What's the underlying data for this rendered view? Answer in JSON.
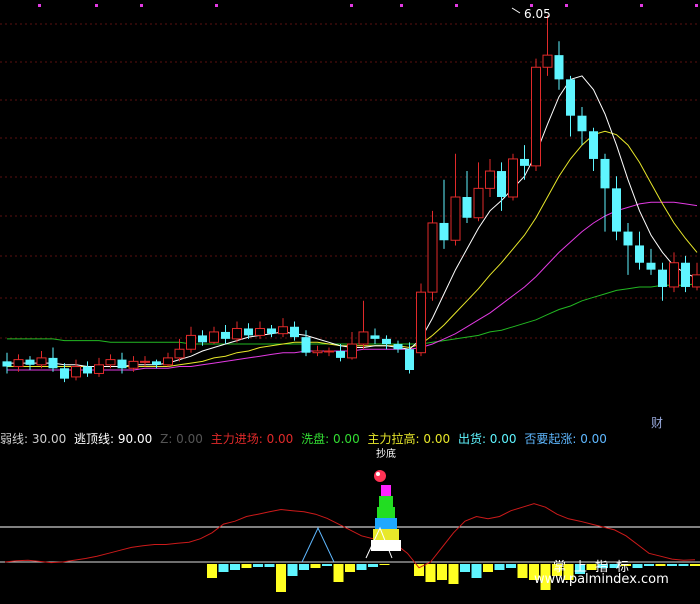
{
  "colors": {
    "background": "#000000",
    "up_candle": "#e02a2a",
    "down_candle": "#5ff5ff",
    "grid": "#5a1010",
    "ma_white": "#ffffff",
    "ma_yellow": "#e8e82a",
    "ma_magenta": "#e23ae2",
    "ma_green": "#22b822",
    "red_line": "#cc1a1a",
    "bar_yellow": "#ffff22",
    "bar_cyan": "#5ff5ff"
  },
  "main_chart": {
    "peak_label": "6.05",
    "corner_label": "财"
  },
  "indicator_bar": [
    {
      "text": "弱线: 30.00",
      "color": "#cfcfcf"
    },
    {
      "text": "逃顶线: 90.00",
      "color": "#ffffff"
    },
    {
      "text": "Z: 0.00",
      "color": "#555555"
    },
    {
      "text": "主力进场: 0.00",
      "color": "#e02a2a"
    },
    {
      "text": "洗盘: 0.00",
      "color": "#33dd33"
    },
    {
      "text": "主力拉高: 0.00",
      "color": "#e8e82a"
    },
    {
      "text": "出货: 0.00",
      "color": "#5ff5ff"
    },
    {
      "text": "否要起涨: 0.00",
      "color": "#5fb8ff"
    }
  ],
  "sub_chart": {
    "top_label": "抄底",
    "lines": [
      {
        "name": "逃顶线",
        "value": 90
      },
      {
        "name": "弱线",
        "value": 30
      }
    ]
  },
  "watermark": {
    "cn": "掌上指标",
    "url": "www.palmindex.com"
  },
  "chart_data": {
    "type": "candlestick",
    "candles": [
      [
        4.05,
        4.02,
        4.1,
        3.98
      ],
      [
        4.02,
        4.06,
        4.09,
        3.99
      ],
      [
        4.06,
        4.03,
        4.08,
        4.0
      ],
      [
        4.03,
        4.07,
        4.11,
        4.01
      ],
      [
        4.07,
        4.01,
        4.13,
        3.99
      ],
      [
        4.01,
        3.95,
        4.04,
        3.93
      ],
      [
        3.96,
        4.02,
        4.06,
        3.94
      ],
      [
        4.02,
        3.98,
        4.05,
        3.96
      ],
      [
        3.98,
        4.03,
        4.07,
        3.96
      ],
      [
        4.03,
        4.06,
        4.09,
        4.01
      ],
      [
        4.06,
        4.01,
        4.1,
        3.98
      ],
      [
        4.01,
        4.05,
        4.08,
        3.99
      ],
      [
        4.05,
        4.05,
        4.08,
        4.02
      ],
      [
        4.05,
        4.03,
        4.06,
        4.01
      ],
      [
        4.03,
        4.07,
        4.1,
        4.02
      ],
      [
        4.07,
        4.12,
        4.18,
        4.05
      ],
      [
        4.12,
        4.2,
        4.25,
        4.1
      ],
      [
        4.2,
        4.16,
        4.23,
        4.14
      ],
      [
        4.16,
        4.22,
        4.25,
        4.15
      ],
      [
        4.22,
        4.18,
        4.26,
        4.15
      ],
      [
        4.18,
        4.24,
        4.28,
        4.16
      ],
      [
        4.24,
        4.2,
        4.27,
        4.18
      ],
      [
        4.2,
        4.24,
        4.28,
        4.18
      ],
      [
        4.24,
        4.21,
        4.26,
        4.19
      ],
      [
        4.21,
        4.25,
        4.3,
        4.19
      ],
      [
        4.25,
        4.19,
        4.28,
        4.17
      ],
      [
        4.19,
        4.1,
        4.23,
        4.08
      ],
      [
        4.1,
        4.11,
        4.14,
        4.08
      ],
      [
        4.11,
        4.11,
        4.13,
        4.08
      ],
      [
        4.11,
        4.07,
        4.15,
        4.05
      ],
      [
        4.07,
        4.15,
        4.22,
        4.06
      ],
      [
        4.15,
        4.22,
        4.4,
        4.12
      ],
      [
        4.2,
        4.18,
        4.24,
        4.15
      ],
      [
        4.18,
        4.15,
        4.2,
        4.12
      ],
      [
        4.15,
        4.12,
        4.17,
        4.1
      ],
      [
        4.12,
        4.0,
        4.16,
        3.98
      ],
      [
        4.1,
        4.45,
        4.5,
        4.08
      ],
      [
        4.45,
        4.85,
        4.92,
        4.4
      ],
      [
        4.85,
        4.75,
        5.1,
        4.7
      ],
      [
        4.75,
        5.0,
        5.25,
        4.72
      ],
      [
        5.0,
        4.88,
        5.15,
        4.85
      ],
      [
        4.88,
        5.05,
        5.2,
        4.86
      ],
      [
        5.05,
        5.15,
        5.22,
        5.0
      ],
      [
        5.15,
        5.0,
        5.2,
        4.92
      ],
      [
        5.0,
        5.22,
        5.25,
        4.98
      ],
      [
        5.22,
        5.18,
        5.3,
        5.1
      ],
      [
        5.18,
        5.75,
        5.8,
        5.15
      ],
      [
        5.75,
        5.82,
        6.05,
        5.7
      ],
      [
        5.82,
        5.68,
        5.9,
        5.62
      ],
      [
        5.68,
        5.47,
        5.7,
        5.35
      ],
      [
        5.47,
        5.38,
        5.52,
        5.3
      ],
      [
        5.38,
        5.22,
        5.4,
        5.15
      ],
      [
        5.22,
        5.05,
        5.25,
        4.8
      ],
      [
        5.05,
        4.8,
        5.12,
        4.75
      ],
      [
        4.8,
        4.72,
        4.85,
        4.55
      ],
      [
        4.72,
        4.62,
        4.8,
        4.58
      ],
      [
        4.62,
        4.58,
        4.7,
        4.55
      ],
      [
        4.58,
        4.48,
        4.62,
        4.4
      ],
      [
        4.48,
        4.62,
        4.68,
        4.45
      ],
      [
        4.62,
        4.48,
        4.66,
        4.45
      ],
      [
        4.48,
        4.55,
        4.62,
        4.46
      ]
    ],
    "ma_white": [
      4.04,
      4.04,
      4.04,
      4.04,
      4.04,
      4.03,
      4.03,
      4.02,
      4.02,
      4.02,
      4.02,
      4.03,
      4.03,
      4.03,
      4.04,
      4.06,
      4.08,
      4.11,
      4.13,
      4.15,
      4.17,
      4.19,
      4.2,
      4.21,
      4.22,
      4.21,
      4.2,
      4.18,
      4.16,
      4.14,
      4.13,
      4.13,
      4.14,
      4.14,
      4.13,
      4.12,
      4.18,
      4.3,
      4.44,
      4.58,
      4.7,
      4.82,
      4.92,
      4.98,
      5.05,
      5.12,
      5.25,
      5.42,
      5.58,
      5.68,
      5.7,
      5.62,
      5.48,
      5.3,
      5.1,
      4.92,
      4.78,
      4.68,
      4.6,
      4.56,
      4.53
    ],
    "ma_yellow": [
      4.02,
      4.02,
      4.02,
      4.02,
      4.02,
      4.02,
      4.02,
      4.02,
      4.02,
      4.02,
      4.02,
      4.02,
      4.02,
      4.02,
      4.02,
      4.03,
      4.04,
      4.05,
      4.07,
      4.08,
      4.1,
      4.11,
      4.13,
      4.14,
      4.15,
      4.16,
      4.16,
      4.16,
      4.15,
      4.14,
      4.14,
      4.14,
      4.14,
      4.14,
      4.14,
      4.13,
      4.15,
      4.2,
      4.26,
      4.33,
      4.4,
      4.47,
      4.55,
      4.62,
      4.7,
      4.78,
      4.88,
      5.0,
      5.12,
      5.22,
      5.3,
      5.36,
      5.38,
      5.36,
      5.3,
      5.2,
      5.08,
      4.96,
      4.85,
      4.76,
      4.68
    ],
    "ma_magenta": [
      4.0,
      4.0,
      4.0,
      4.0,
      4.0,
      4.0,
      4.0,
      4.0,
      4.0,
      4.0,
      4.0,
      4.0,
      4.01,
      4.01,
      4.01,
      4.02,
      4.02,
      4.03,
      4.04,
      4.05,
      4.06,
      4.07,
      4.08,
      4.09,
      4.1,
      4.1,
      4.11,
      4.11,
      4.11,
      4.11,
      4.11,
      4.12,
      4.12,
      4.12,
      4.12,
      4.12,
      4.13,
      4.15,
      4.18,
      4.21,
      4.25,
      4.29,
      4.33,
      4.38,
      4.43,
      4.48,
      4.54,
      4.61,
      4.68,
      4.74,
      4.8,
      4.85,
      4.89,
      4.92,
      4.94,
      4.96,
      4.97,
      4.97,
      4.97,
      4.96,
      4.95
    ],
    "ma_green": [
      4.18,
      4.18,
      4.18,
      4.18,
      4.18,
      4.17,
      4.17,
      4.17,
      4.17,
      4.16,
      4.16,
      4.16,
      4.16,
      4.16,
      4.16,
      4.16,
      4.15,
      4.15,
      4.15,
      4.15,
      4.15,
      4.15,
      4.15,
      4.15,
      4.15,
      4.15,
      4.15,
      4.15,
      4.15,
      4.15,
      4.15,
      4.15,
      4.15,
      4.15,
      4.15,
      4.15,
      4.15,
      4.16,
      4.17,
      4.18,
      4.19,
      4.2,
      4.22,
      4.23,
      4.25,
      4.27,
      4.29,
      4.32,
      4.35,
      4.37,
      4.4,
      4.42,
      4.44,
      4.46,
      4.47,
      4.48,
      4.48,
      4.49,
      4.49,
      4.49,
      4.5
    ],
    "sub_red": [
      30,
      32,
      33,
      31,
      29,
      30,
      33,
      36,
      40,
      45,
      50,
      55,
      58,
      60,
      60,
      62,
      64,
      70,
      80,
      95,
      100,
      108,
      112,
      116,
      120,
      118,
      116,
      112,
      105,
      95,
      85,
      75,
      70,
      68,
      60,
      45,
      20,
      30,
      55,
      80,
      100,
      108,
      104,
      108,
      118,
      124,
      130,
      124,
      112,
      104,
      100,
      95,
      90,
      85,
      75,
      60,
      45,
      40,
      35,
      33,
      34
    ],
    "sub_volume": [
      0,
      0,
      0,
      0,
      0,
      0,
      0,
      0,
      0,
      0,
      0,
      0,
      0,
      0,
      0,
      0,
      0,
      0,
      -14,
      -8,
      -6,
      -4,
      -3,
      -3,
      -28,
      -12,
      -6,
      -4,
      -2,
      -18,
      -8,
      -6,
      -3,
      -1,
      0,
      0,
      -12,
      -18,
      -16,
      -20,
      -8,
      -14,
      -8,
      -6,
      -4,
      -14,
      -16,
      -26,
      -12,
      -16,
      -10,
      -6,
      -4,
      -4,
      -2,
      -4,
      -2,
      -2,
      -2,
      -2,
      -2
    ]
  }
}
